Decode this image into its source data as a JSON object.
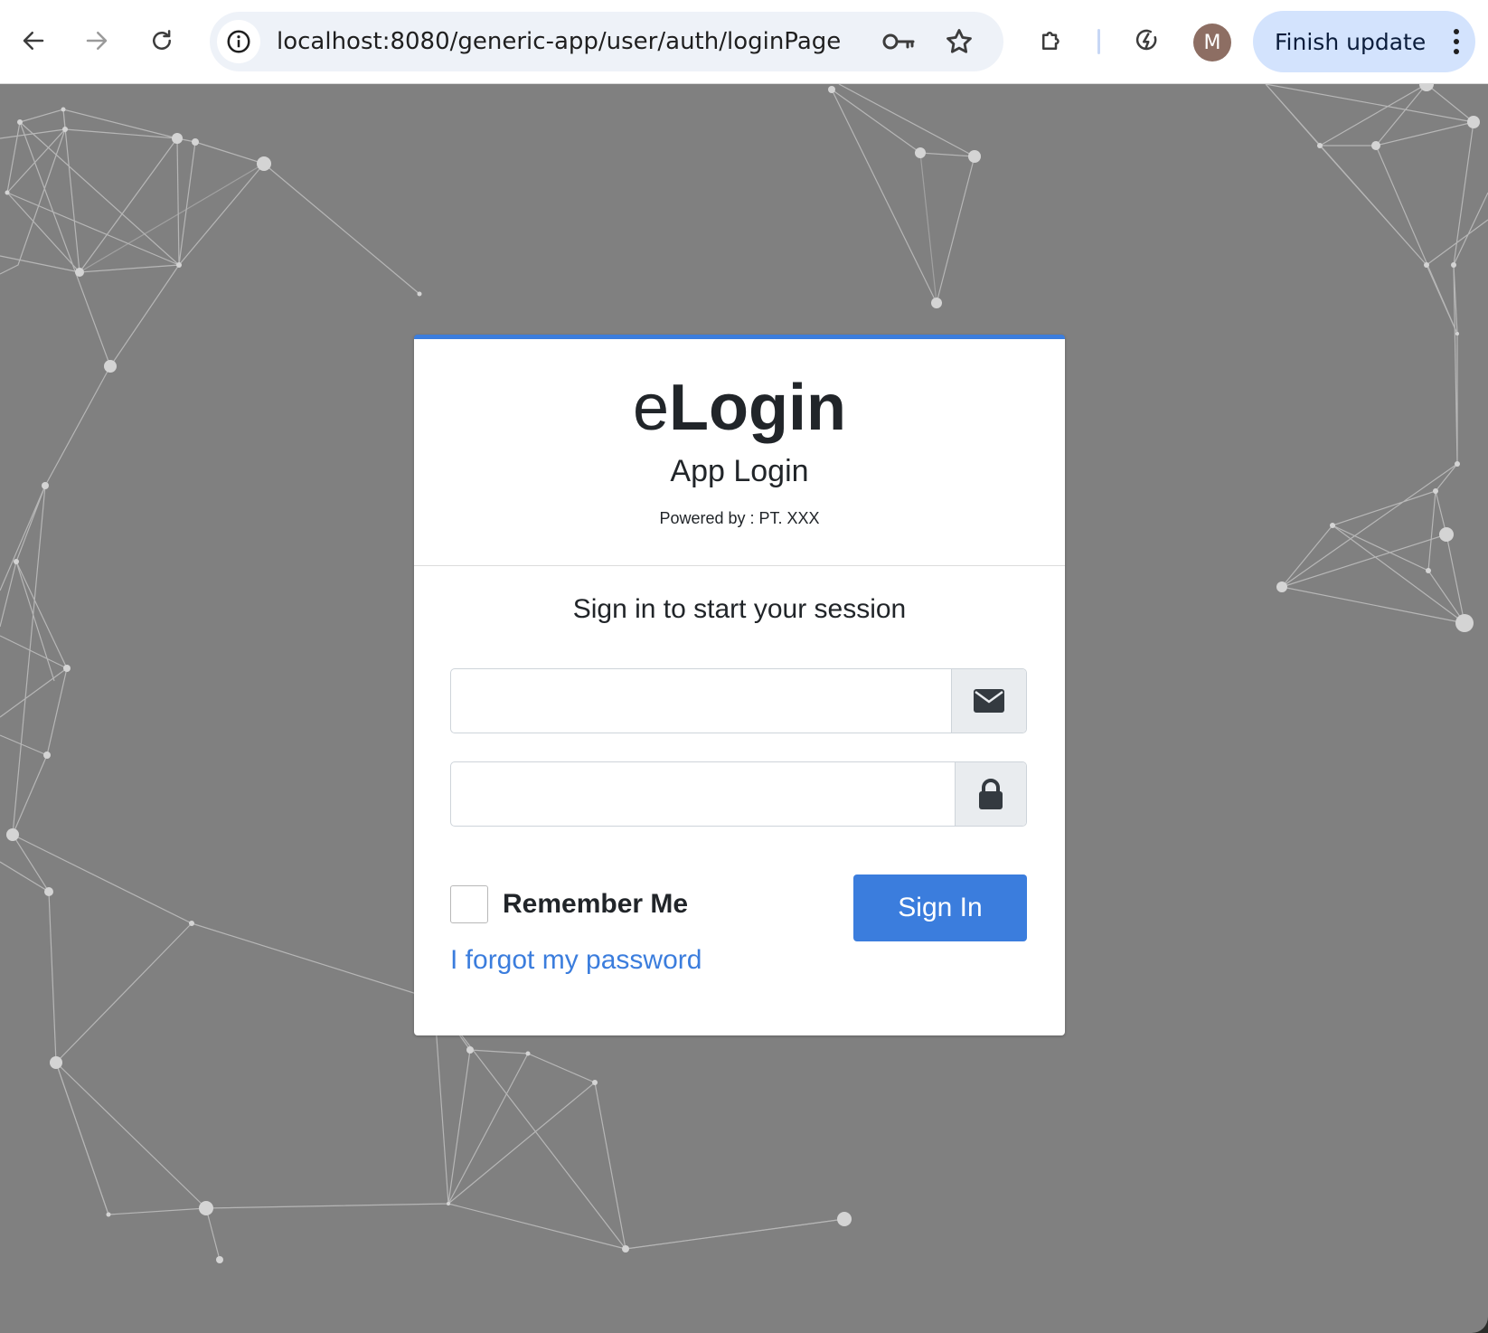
{
  "browser": {
    "url": "localhost:8080/generic-app/user/auth/loginPage",
    "profile_initial": "M",
    "finish_update_label": "Finish update",
    "icons": {
      "back": "arrow-left-icon",
      "forward": "arrow-right-icon",
      "reload": "reload-icon",
      "site_info": "info-icon",
      "passwords": "key-icon",
      "bookmark": "star-icon",
      "extensions": "puzzle-icon",
      "performance": "energy-saver-icon",
      "menu": "kebab-menu-icon"
    }
  },
  "login": {
    "brand_prefix": "e",
    "brand_main": "Login",
    "app_title": "App Login",
    "powered_by": "Powered by : PT. XXX",
    "message": "Sign in to start your session",
    "email": {
      "value": "",
      "placeholder": "",
      "icon": "envelope-icon"
    },
    "password": {
      "value": "",
      "placeholder": "",
      "icon": "lock-icon"
    },
    "remember_label": "Remember Me",
    "remember_checked": false,
    "sign_in_label": "Sign In",
    "forgot_label": "I forgot my password"
  },
  "colors": {
    "page_background": "#808080",
    "accent": "#3b7ddd",
    "update_chip": "#d3e3fd",
    "avatar": "#8d6e63"
  }
}
